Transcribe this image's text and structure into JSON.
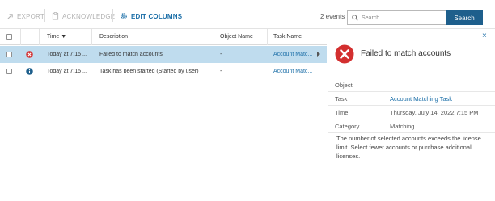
{
  "toolbar": {
    "export_label": "EXPORT",
    "acknowledge_label": "ACKNOWLEDGE",
    "edit_columns_label": "EDIT COLUMNS",
    "events_count": "2 events",
    "search_placeholder": "Search",
    "search_button_label": "Search"
  },
  "table": {
    "columns": [
      "Time ▼",
      "Description",
      "Object Name",
      "Task Name"
    ],
    "rows": [
      {
        "status_icon": "error-icon",
        "time": "Today at 7:15 ...",
        "description": "Failed to match accounts",
        "object_name": "-",
        "task_name": "Account Matc...",
        "selected": true
      },
      {
        "status_icon": "info-icon",
        "time": "Today at 7:15 ...",
        "description": "Task has been started (Started by user)",
        "object_name": "-",
        "task_name": "Account Matc...",
        "selected": false
      }
    ]
  },
  "detail": {
    "close_glyph": "×",
    "title": "Failed to match accounts",
    "properties": [
      {
        "label": "Object",
        "value": "",
        "is_link": false
      },
      {
        "label": "Task",
        "value": "Account Matching Task",
        "is_link": true
      },
      {
        "label": "Time",
        "value": "Thursday, July 14, 2022 7:15 PM",
        "is_link": false
      },
      {
        "label": "Category",
        "value": "Matching",
        "is_link": false
      }
    ],
    "description": "The number of selected accounts exceeds the license limit. Select fewer accounts or purchase additional licenses."
  },
  "colors": {
    "accent": "#1c6fa8",
    "selected_row": "#bfdcee",
    "error": "#d32f2f",
    "info": "#1e5f8c",
    "search_button": "#1e5f8c"
  }
}
